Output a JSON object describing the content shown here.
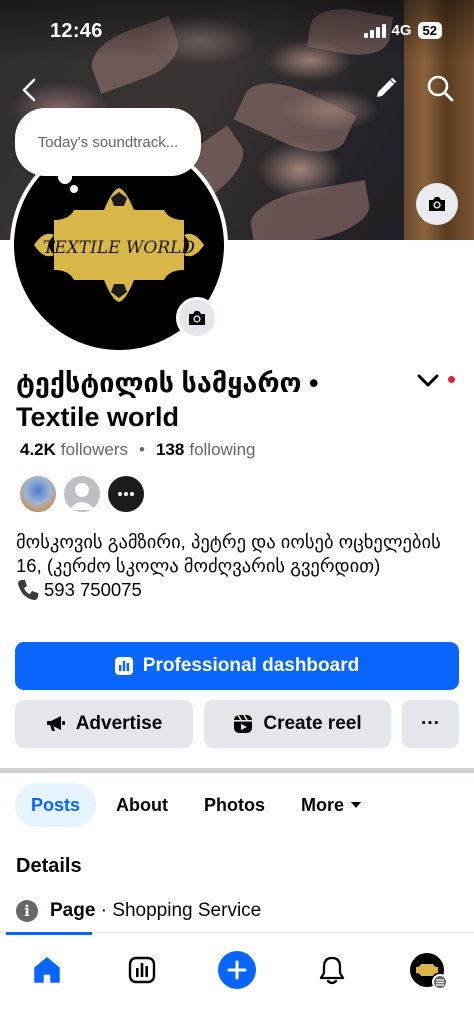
{
  "status_bar": {
    "time": "12:46",
    "network": "4G",
    "battery": "52"
  },
  "note": {
    "text": "Today's soundtrack..."
  },
  "logo": {
    "text": "TEXTILE WORLD"
  },
  "profile": {
    "name": "ტექსტილის სამყარო • Textile world",
    "followers_count": "4.2K",
    "followers_label": "followers",
    "following_count": "138",
    "following_label": "following",
    "bio_address": "მოსკოვის გამზირი, პეტრე და იოსებ ოცხელების 16, (კერძო სკოლა მოძღვარის გვერდით)",
    "bio_phone": "593 750075"
  },
  "buttons": {
    "professional_dashboard": "Professional dashboard",
    "advertise": "Advertise",
    "create_reel": "Create reel",
    "more": "···"
  },
  "tabs": [
    {
      "label": "Posts",
      "active": true
    },
    {
      "label": "About",
      "active": false
    },
    {
      "label": "Photos",
      "active": false
    },
    {
      "label": "More",
      "active": false
    }
  ],
  "details": {
    "title": "Details",
    "type_label": "Page",
    "separator": " · ",
    "category": "Shopping Service"
  },
  "bottom_nav": [
    "home-icon",
    "dashboard-icon",
    "create-icon",
    "notifications-icon",
    "profile-menu-icon"
  ],
  "colors": {
    "accent": "#0866ff",
    "gray_button": "#e4e6eb",
    "logo_gold": "#d9b648",
    "notification_dot": "#e41e3f"
  }
}
